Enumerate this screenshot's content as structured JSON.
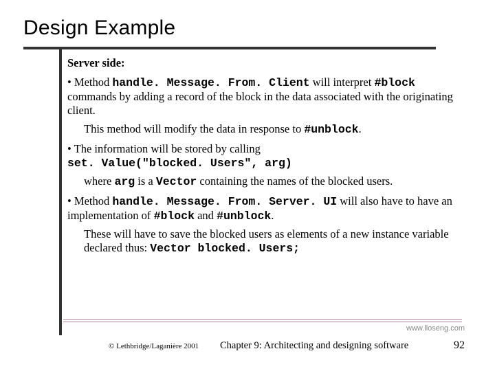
{
  "title": "Design Example",
  "subhead": "Server side:",
  "bullet1": {
    "mark": "• ",
    "pre": "Method ",
    "code1": "handle. Message. From. Client",
    "mid": " will interpret ",
    "code2": "#block",
    "post": " commands by adding a record of the block in the data associated with the originating client."
  },
  "indent1": {
    "pre": "This method will modify the data in response to ",
    "code": "#unblock",
    "post": "."
  },
  "bullet2": {
    "mark": "• ",
    "pre": "The information will be stored by calling ",
    "code": "set. Value(\"blocked. Users\", arg)"
  },
  "indent2": {
    "pre": "where ",
    "code1": "arg",
    "mid": " is a ",
    "code2": "Vector",
    "post": " containing the names of the blocked users."
  },
  "bullet3": {
    "mark": "• ",
    "pre": "Method ",
    "code1": "handle. Message. From. Server. UI",
    "mid": " will also have to have an implementation of ",
    "code2": "#block",
    "and": " and ",
    "code3": "#unblock",
    "post": "."
  },
  "indent3": {
    "pre": "These will have to save the blocked users as elements of a new instance variable declared thus: ",
    "code": "Vector blocked. Users;"
  },
  "url": "www.lloseng.com",
  "copyright": "© Lethbridge/Laganière 2001",
  "chapter": "Chapter 9: Architecting and designing software",
  "pagenum": "92"
}
